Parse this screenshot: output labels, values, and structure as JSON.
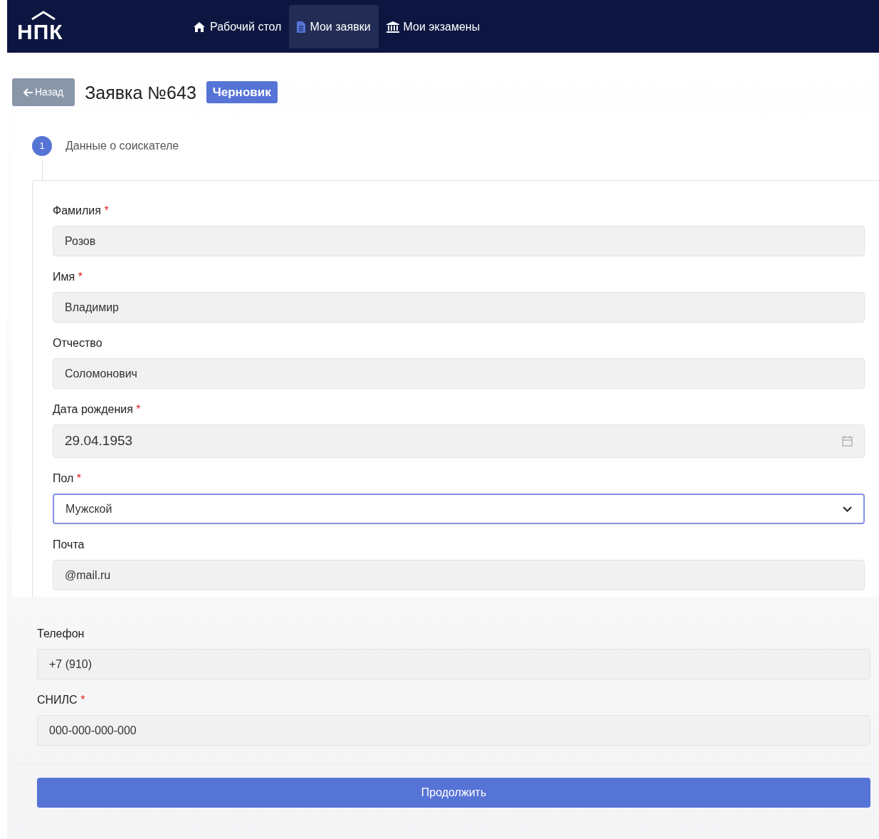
{
  "navbar": {
    "logo": "НПК",
    "items": [
      {
        "label": "Рабочий стол",
        "kind": "home",
        "selected": false
      },
      {
        "label": "Мои заявки",
        "kind": "requests",
        "selected": true
      },
      {
        "label": "Мои экзамены",
        "kind": "exams",
        "selected": false
      }
    ]
  },
  "header": {
    "back_button": "Назад",
    "title": "Заявка №643",
    "status_badge": "Черновик"
  },
  "step": {
    "number": "1",
    "title": "Данные о соискателе"
  },
  "fields": [
    {
      "kind": "text",
      "label": "Фамилия",
      "required_mark": "*",
      "value": "Розов"
    },
    {
      "kind": "text",
      "label": "Имя",
      "required_mark": "*",
      "value": "Владимир"
    },
    {
      "kind": "text",
      "label": "Отчество",
      "value": "Соломонович"
    },
    {
      "kind": "date",
      "label": "Дата рождения",
      "required_mark": "*",
      "value": "29.04.1953"
    },
    {
      "kind": "select",
      "label": "Пол",
      "required_mark": "*",
      "value": "Мужской",
      "focused": true
    },
    {
      "kind": "text",
      "label": "Почта",
      "value": "@mail.ru"
    }
  ],
  "fields_lower": [
    {
      "label": "Телефон",
      "value": "+7 (910)"
    },
    {
      "label": "СНИЛС",
      "required_mark": "*",
      "value": "000-000-000-000"
    }
  ],
  "submit_button": "Продолжить"
}
